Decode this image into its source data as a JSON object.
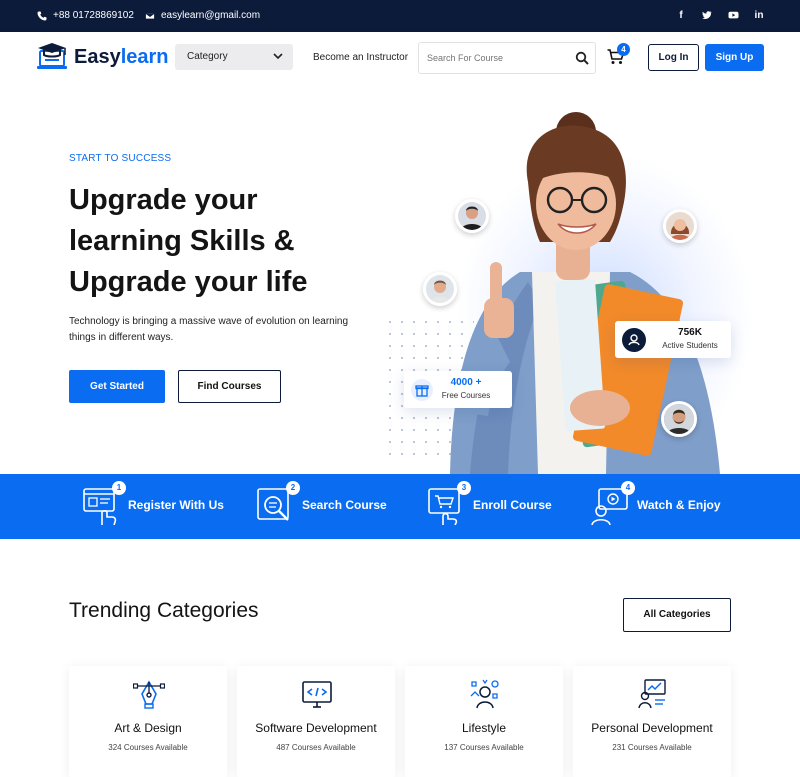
{
  "topbar": {
    "phone": "+88 01728869102",
    "email": "easylearn@gmail.com",
    "social": [
      "facebook-icon",
      "twitter-icon",
      "youtube-icon",
      "linkedin-icon"
    ]
  },
  "header": {
    "logo_prefix": "Easy",
    "logo_accent": "learn",
    "category_label": "Category",
    "become_instructor": "Become an Instructor",
    "search_placeholder": "Search For Course",
    "cart_count": "4",
    "login_label": "Log In",
    "signup_label": "Sign Up"
  },
  "hero": {
    "eyebrow": "START TO SUCCESS",
    "title": "Upgrade your learning Skills & Upgrade your life",
    "subtitle": "Technology is bringing a massive wave of evolution on learning things in different ways.",
    "primary_button": "Get Started",
    "secondary_button": "Find Courses",
    "stat_students_value": "756K",
    "stat_students_label": "Active Students",
    "stat_courses_value": "4000 +",
    "stat_courses_label": "Free Courses"
  },
  "steps": [
    {
      "number": "1",
      "label": "Register With Us",
      "icon": "register-icon"
    },
    {
      "number": "2",
      "label": "Search Course",
      "icon": "search-course-icon"
    },
    {
      "number": "3",
      "label": "Enroll Course",
      "icon": "enroll-icon"
    },
    {
      "number": "4",
      "label": "Watch & Enjoy",
      "icon": "watch-icon"
    }
  ],
  "trending": {
    "title": "Trending Categories",
    "all_button": "All Categories",
    "categories": [
      {
        "name": "Art & Design",
        "count": "324 Courses Available",
        "icon": "pen-tool-icon"
      },
      {
        "name": "Software Development",
        "count": "487 Courses Available",
        "icon": "code-monitor-icon"
      },
      {
        "name": "Lifestyle",
        "count": "137 Courses Available",
        "icon": "lifestyle-icon"
      },
      {
        "name": "Personal Development",
        "count": "231 Courses Available",
        "icon": "growth-icon"
      }
    ]
  },
  "colors": {
    "accent": "#0a6cf0",
    "dark": "#0c1b3a"
  }
}
